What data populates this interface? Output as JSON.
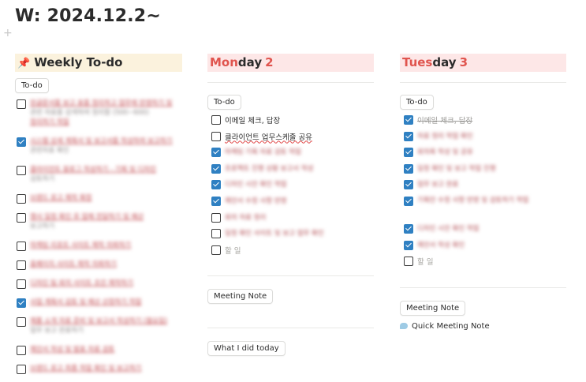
{
  "page": {
    "title": "W: 2024.12.2~"
  },
  "columns": {
    "weekly": {
      "title": "Weekly To-do",
      "pill": "To-do",
      "items": [
        {
          "checked": false,
          "lines": [
            "한글문서를 보고 표를 정리하고 업무에 반영하기 및",
            "관련 자료를 검색하여 정리함 (500~600)",
            "정리하기 작업"
          ]
        },
        {
          "checked": true,
          "lines": [
            "시스템 상세 계획서 및 보고서를 작성하여 보고하기",
            "관련자료 확인"
          ]
        },
        {
          "checked": false,
          "lines": [
            "클라이언트 블로그 작성하기 - 기획 및 디자인",
            "검토하기"
          ]
        },
        {
          "checked": false,
          "lines": [
            "브랜드 로고 제작 확정"
          ]
        },
        {
          "checked": false,
          "lines": [
            "행사 일정 확인 후 업체 전달하기 및 예산",
            "보고하기"
          ]
        },
        {
          "checked": false,
          "lines": [
            "마케팅 리포트 사이트 제작 의뢰하기"
          ]
        },
        {
          "checked": false,
          "lines": [
            "홈페이지 사이트 제작 의뢰하기"
          ]
        },
        {
          "checked": false,
          "lines": [
            "디자인 팀 회의 사이트 초안 제작하기"
          ]
        },
        {
          "checked": true,
          "lines": [
            "사업 계획서 검토 및 예산 산정하기 작업"
          ]
        },
        {
          "checked": false,
          "lines": [
            "제품 소개 자료 준비 및 보고서 작성하기 (월요일)",
            "업무 보고 완료하기"
          ]
        },
        {
          "checked": false,
          "lines": [
            "제안서 작성 및 발표 자료 검토"
          ]
        },
        {
          "checked": false,
          "lines": [
            "브랜드 로고 최종 작업 확인 및 보고하기"
          ]
        }
      ]
    },
    "monday": {
      "day_accent": "Mon",
      "day_rest": "day",
      "day_num": "2",
      "pill": "To-do",
      "items": [
        {
          "checked": false,
          "text": "이메일 체크, 답장",
          "kind": "text"
        },
        {
          "checked": false,
          "text": "클라이언트 업무스케줄 공유",
          "kind": "text"
        },
        {
          "checked": true,
          "text": "마케팅 기획 자료 검토 작업",
          "kind": "blur"
        },
        {
          "checked": true,
          "text": "프로젝트 진행 상황 보고서 작성",
          "kind": "blur"
        },
        {
          "checked": true,
          "text": "디자인 시안 확인 작업",
          "kind": "blur"
        },
        {
          "checked": true,
          "text": "제안서 수정 사항 반영",
          "kind": "blur"
        },
        {
          "checked": false,
          "text": "회의 자료 정리",
          "kind": "blur"
        },
        {
          "checked": false,
          "text": "일정 확인 사이트 및 보고 업무 확인",
          "kind": "blur"
        },
        {
          "checked": false,
          "text": "할 일",
          "kind": "placeholder"
        }
      ],
      "meeting_pill": "Meeting Note",
      "today_pill": "What I did today"
    },
    "tuesday": {
      "day_accent": "Tues",
      "day_rest": "day",
      "day_num": "3",
      "pill": "To-do",
      "items": [
        {
          "checked": true,
          "text": "이메일 체크, 답장",
          "kind": "done"
        },
        {
          "checked": true,
          "text": "자료 정리 작업 확인",
          "kind": "blur"
        },
        {
          "checked": true,
          "text": "회의록 작성 및 공유",
          "kind": "blur"
        },
        {
          "checked": true,
          "text": "일정 확인 및 보고 작업 진행",
          "kind": "blur"
        },
        {
          "checked": true,
          "text": "업무 보고 완료",
          "kind": "blur"
        },
        {
          "checked": true,
          "text": "기획안 수정 사항 반영 및 검토하기 작업",
          "kind": "blur2"
        },
        {
          "checked": true,
          "text": "디자인 시안 확인 작업",
          "kind": "blur"
        },
        {
          "checked": true,
          "text": "제안서 작성 확인",
          "kind": "blur"
        },
        {
          "checked": false,
          "text": "할 일",
          "kind": "placeholder"
        }
      ],
      "meeting_pill": "Meeting Note",
      "quick_note": "Quick Meeting Note"
    }
  }
}
